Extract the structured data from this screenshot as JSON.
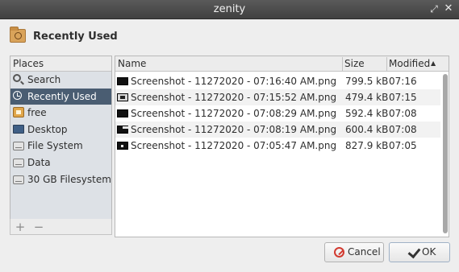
{
  "window": {
    "title": "zenity"
  },
  "header": {
    "label": "Recently Used"
  },
  "places": {
    "heading": "Places",
    "items": [
      {
        "label": "Search",
        "icon": "search-icon",
        "selected": false
      },
      {
        "label": "Recently Used",
        "icon": "recent-icon",
        "selected": true
      },
      {
        "label": "free",
        "icon": "home-folder-icon",
        "selected": false
      },
      {
        "label": "Desktop",
        "icon": "desktop-icon",
        "selected": false
      },
      {
        "label": "File System",
        "icon": "drive-icon",
        "selected": false
      },
      {
        "label": "Data",
        "icon": "drive-icon",
        "selected": false
      },
      {
        "label": "30 GB Filesystem",
        "icon": "drive-icon",
        "selected": false
      }
    ],
    "add_label": "+",
    "remove_label": "−"
  },
  "files": {
    "columns": {
      "name": "Name",
      "size": "Size",
      "modified": "Modified"
    },
    "sort": {
      "column": "Modified",
      "direction": "ascending"
    },
    "rows": [
      {
        "name": "Screenshot - 11272020 - 07:16:40 AM.png",
        "size": "799.5 kB",
        "modified": "07:16"
      },
      {
        "name": "Screenshot - 11272020 - 07:15:52 AM.png",
        "size": "479.4 kB",
        "modified": "07:15"
      },
      {
        "name": "Screenshot - 11272020 - 07:08:29 AM.png",
        "size": "592.4 kB",
        "modified": "07:08"
      },
      {
        "name": "Screenshot - 11272020 - 07:08:19 AM.png",
        "size": "600.4 kB",
        "modified": "07:08"
      },
      {
        "name": "Screenshot - 11272020 - 07:05:47 AM.png",
        "size": "827.9 kB",
        "modified": "07:05"
      }
    ]
  },
  "buttons": {
    "cancel": "Cancel",
    "ok": "OK"
  },
  "colors": {
    "selection": "#4a5d72",
    "cancel_icon": "#d23a30"
  }
}
